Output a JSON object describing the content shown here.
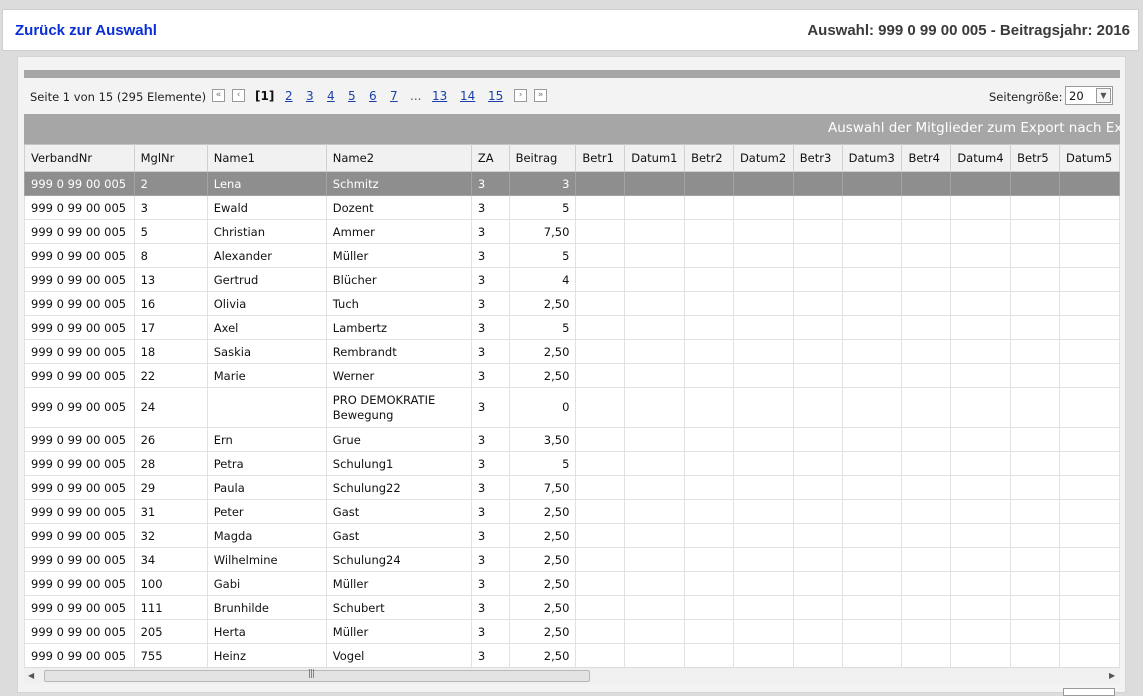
{
  "header": {
    "back_link": "Zurück zur Auswahl",
    "selection_info": "Auswahl: 999 0 99 00 005 - Beitragsjahr: 2016"
  },
  "pager": {
    "info": "Seite 1 von 15 (295 Elemente)",
    "first_icon": "double-chevron-left-icon",
    "prev_icon": "chevron-left-icon",
    "current": "[1]",
    "pages": [
      "2",
      "3",
      "4",
      "5",
      "6",
      "7"
    ],
    "ellipsis": "...",
    "pages_tail": [
      "13",
      "14",
      "15"
    ],
    "next_icon": "chevron-right-icon",
    "last_icon": "double-chevron-right-icon",
    "page_size_label": "Seitengröße:",
    "page_size_value": "20"
  },
  "caption": "Auswahl der Mitglieder zum Export nach Excel",
  "columns": [
    "VerbandNr",
    "MglNr",
    "Name1",
    "Name2",
    "ZA",
    "Beitrag",
    "Betr1",
    "Datum1",
    "Betr2",
    "Datum2",
    "Betr3",
    "Datum3",
    "Betr4",
    "Datum4",
    "Betr5",
    "Datum5"
  ],
  "rows": [
    {
      "verband": "999 0 99 00 005",
      "mgl": "2",
      "name1": "Lena",
      "name2": "Schmitz",
      "za": "3",
      "beitrag": "3",
      "selected": true
    },
    {
      "verband": "999 0 99 00 005",
      "mgl": "3",
      "name1": "Ewald",
      "name2": "Dozent",
      "za": "3",
      "beitrag": "5"
    },
    {
      "verband": "999 0 99 00 005",
      "mgl": "5",
      "name1": "Christian",
      "name2": "Ammer",
      "za": "3",
      "beitrag": "7,50"
    },
    {
      "verband": "999 0 99 00 005",
      "mgl": "8",
      "name1": "Alexander",
      "name2": "Müller",
      "za": "3",
      "beitrag": "5"
    },
    {
      "verband": "999 0 99 00 005",
      "mgl": "13",
      "name1": "Gertrud",
      "name2": "Blücher",
      "za": "3",
      "beitrag": "4"
    },
    {
      "verband": "999 0 99 00 005",
      "mgl": "16",
      "name1": "Olivia",
      "name2": "Tuch",
      "za": "3",
      "beitrag": "2,50"
    },
    {
      "verband": "999 0 99 00 005",
      "mgl": "17",
      "name1": "Axel",
      "name2": "Lambertz",
      "za": "3",
      "beitrag": "5"
    },
    {
      "verband": "999 0 99 00 005",
      "mgl": "18",
      "name1": "Saskia",
      "name2": "Rembrandt",
      "za": "3",
      "beitrag": "2,50"
    },
    {
      "verband": "999 0 99 00 005",
      "mgl": "22",
      "name1": "Marie",
      "name2": "Werner",
      "za": "3",
      "beitrag": "2,50"
    },
    {
      "verband": "999 0 99 00 005",
      "mgl": "24",
      "name1": "",
      "name2": "PRO DEMOKRATIE Bewegung",
      "za": "3",
      "beitrag": "0",
      "tall": true
    },
    {
      "verband": "999 0 99 00 005",
      "mgl": "26",
      "name1": "Ern",
      "name2": "Grue",
      "za": "3",
      "beitrag": "3,50"
    },
    {
      "verband": "999 0 99 00 005",
      "mgl": "28",
      "name1": "Petra",
      "name2": "Schulung1",
      "za": "3",
      "beitrag": "5"
    },
    {
      "verband": "999 0 99 00 005",
      "mgl": "29",
      "name1": "Paula",
      "name2": "Schulung22",
      "za": "3",
      "beitrag": "7,50"
    },
    {
      "verband": "999 0 99 00 005",
      "mgl": "31",
      "name1": "Peter",
      "name2": "Gast",
      "za": "3",
      "beitrag": "2,50"
    },
    {
      "verband": "999 0 99 00 005",
      "mgl": "32",
      "name1": "Magda",
      "name2": "Gast",
      "za": "3",
      "beitrag": "2,50"
    },
    {
      "verband": "999 0 99 00 005",
      "mgl": "34",
      "name1": "Wilhelmine",
      "name2": "Schulung24",
      "za": "3",
      "beitrag": "2,50"
    },
    {
      "verband": "999 0 99 00 005",
      "mgl": "100",
      "name1": "Gabi",
      "name2": "Müller",
      "za": "3",
      "beitrag": "2,50"
    },
    {
      "verband": "999 0 99 00 005",
      "mgl": "111",
      "name1": "Brunhilde",
      "name2": "Schubert",
      "za": "3",
      "beitrag": "2,50"
    },
    {
      "verband": "999 0 99 00 005",
      "mgl": "205",
      "name1": "Herta",
      "name2": "Müller",
      "za": "3",
      "beitrag": "2,50"
    },
    {
      "verband": "999 0 99 00 005",
      "mgl": "755",
      "name1": "Heinz",
      "name2": "Vogel",
      "za": "3",
      "beitrag": "2,50"
    }
  ],
  "scrollbar": {
    "left_icon": "arrow-left-icon",
    "right_icon": "arrow-right-icon",
    "grip_icon": "grip-icon"
  },
  "colors": {
    "link": "#0a2fd6",
    "selected_row": "#8e8e8e",
    "caption_bar": "#a6a6a6"
  }
}
